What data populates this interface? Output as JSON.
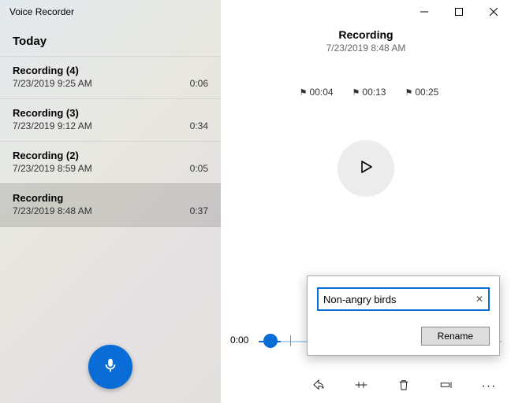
{
  "app_title": "Voice Recorder",
  "section_header": "Today",
  "recordings": [
    {
      "title": "Recording (4)",
      "datetime": "7/23/2019 9:25 AM",
      "duration": "0:06",
      "selected": false
    },
    {
      "title": "Recording (3)",
      "datetime": "7/23/2019 9:12 AM",
      "duration": "0:34",
      "selected": false
    },
    {
      "title": "Recording (2)",
      "datetime": "7/23/2019 8:59 AM",
      "duration": "0:05",
      "selected": false
    },
    {
      "title": "Recording",
      "datetime": "7/23/2019 8:48 AM",
      "duration": "0:37",
      "selected": true
    }
  ],
  "detail": {
    "title": "Recording",
    "datetime": "7/23/2019 8:48 AM",
    "markers": [
      "00:04",
      "00:13",
      "00:25"
    ],
    "current_time": "0:00"
  },
  "rename": {
    "value": "Non-angry birds",
    "button": "Rename"
  },
  "icons": {
    "flag": "⚑"
  }
}
